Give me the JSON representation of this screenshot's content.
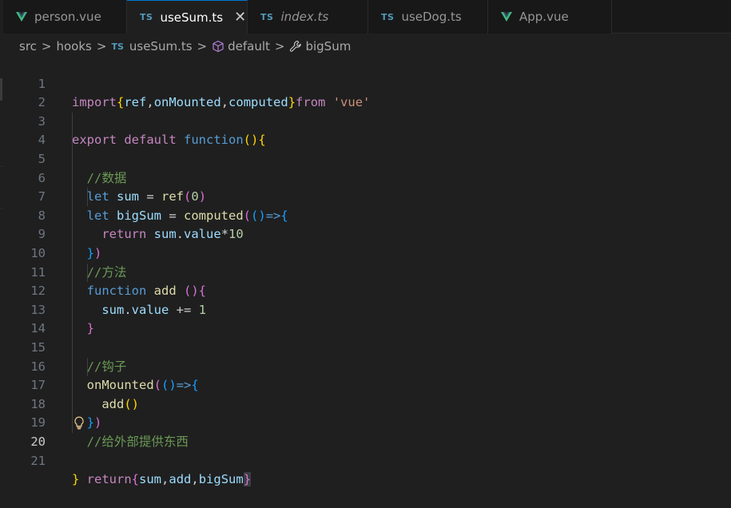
{
  "tabs": [
    {
      "label": "person.vue",
      "icon": "vue-icon",
      "italic": false,
      "active": false
    },
    {
      "label": "useSum.ts",
      "icon": "ts",
      "italic": false,
      "active": true
    },
    {
      "label": "index.ts",
      "icon": "ts",
      "italic": true,
      "active": false
    },
    {
      "label": "useDog.ts",
      "icon": "ts",
      "italic": false,
      "active": false
    },
    {
      "label": "App.vue",
      "icon": "vue-icon",
      "italic": false,
      "active": false
    }
  ],
  "ts_badge": "TS",
  "close_glyph": "✕",
  "breadcrumb": {
    "items": [
      "src",
      "hooks",
      "useSum.ts",
      "default",
      "bigSum"
    ],
    "separator": ">"
  },
  "editor": {
    "current_line": 20,
    "line_numbers": [
      "1",
      "2",
      "3",
      "4",
      "5",
      "6",
      "7",
      "8",
      "9",
      "10",
      "11",
      "12",
      "13",
      "14",
      "15",
      "16",
      "17",
      "18",
      "19",
      "20",
      "21"
    ],
    "lines": [
      "import{ref,onMounted,computed}from 'vue'",
      "",
      "export default function(){",
      "",
      "  //数据",
      "  let sum = ref(0)",
      "  let bigSum = computed(()=>{",
      "    return sum.value*10",
      "  })",
      "  //方法",
      "  function add (){",
      "    sum.value += 1",
      "  }",
      "",
      "  //钩子",
      "  onMounted(()=>{",
      "    add()",
      "  })",
      "  //给外部提供东西",
      "  return{sum,add,bigSum}",
      "}"
    ]
  },
  "colors": {
    "background": "#1f1f1f",
    "tab_bar": "#181818",
    "accent": "#0078d4",
    "keyword_control": "#c586c0",
    "keyword_storage": "#569cd6",
    "function": "#dcdcaa",
    "variable": "#9cdcfe",
    "string": "#ce9178",
    "number": "#b5cea8",
    "comment": "#6a9955"
  },
  "icons": [
    "vue-icon",
    "close-icon",
    "chevron-right-icon",
    "cube-icon",
    "wrench-icon",
    "lightbulb-icon"
  ]
}
